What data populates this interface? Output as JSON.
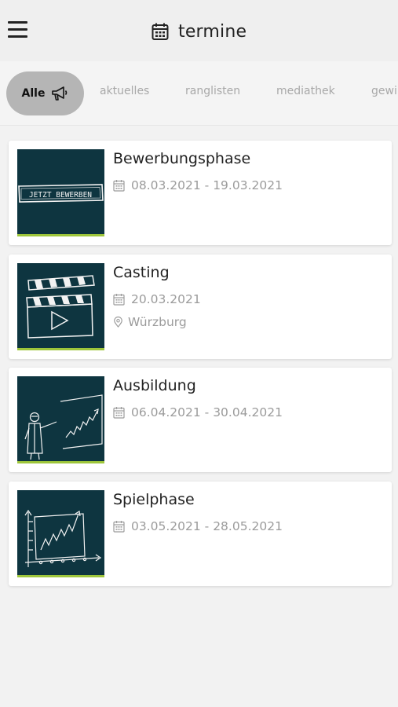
{
  "header": {
    "title": "termine",
    "menu_icon": "hamburger-menu-icon",
    "title_icon": "calendar-icon"
  },
  "tabs": {
    "active": {
      "label": "Alle",
      "icon": "megaphone-icon"
    },
    "items": [
      {
        "label": "aktuelles"
      },
      {
        "label": "ranglisten"
      },
      {
        "label": "mediathek"
      },
      {
        "label": "gewi"
      }
    ]
  },
  "events": [
    {
      "title": "Bewerbungsphase",
      "date": "08.03.2021 - 19.03.2021",
      "thumb_text": "JETZT BEWERBEN",
      "thumb_icon": "apply-sign-illustration"
    },
    {
      "title": "Casting",
      "date": "20.03.2021",
      "location": "Würzburg",
      "thumb_icon": "clapperboard-illustration"
    },
    {
      "title": "Ausbildung",
      "date": "06.04.2021 - 30.04.2021",
      "thumb_icon": "presenter-chart-illustration"
    },
    {
      "title": "Spielphase",
      "date": "03.05.2021 - 28.05.2021",
      "thumb_icon": "rising-chart-illustration"
    }
  ],
  "colors": {
    "thumb_bg": "#0e3540",
    "thumb_accent": "#9ec63b",
    "active_tab": "#b5b5b5",
    "meta_text": "#9b9b9b"
  }
}
